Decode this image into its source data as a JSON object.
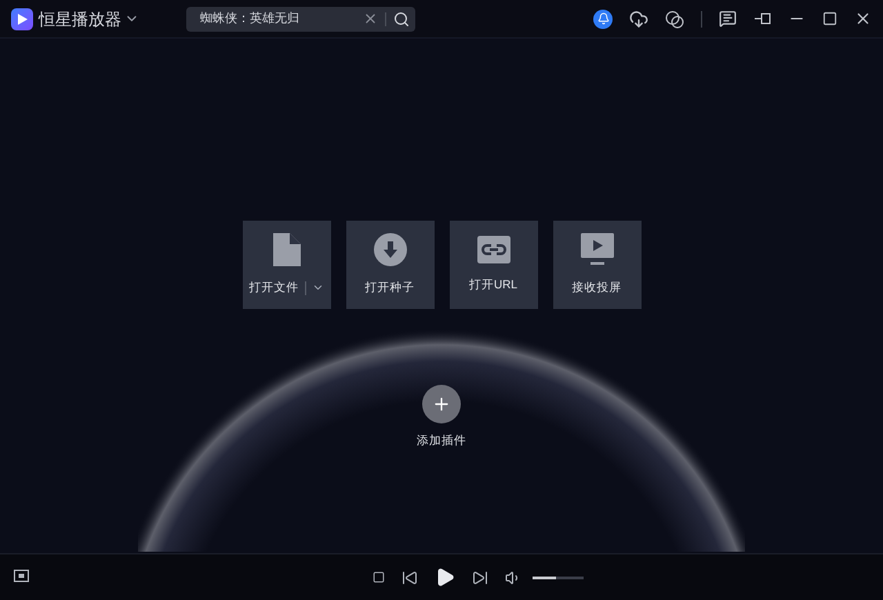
{
  "app": {
    "title": "恒星播放器"
  },
  "search": {
    "value": "蜘蛛侠：英雄无归"
  },
  "actions": [
    {
      "kind": "file",
      "label": "打开文件",
      "has_menu": true
    },
    {
      "kind": "torrent",
      "label": "打开种子",
      "has_menu": false
    },
    {
      "kind": "url",
      "label": "打开URL",
      "has_menu": false
    },
    {
      "kind": "cast",
      "label": "接收投屏",
      "has_menu": false
    }
  ],
  "plugin": {
    "label": "添加插件"
  },
  "player": {
    "volume": {
      "level": 0.45
    }
  }
}
